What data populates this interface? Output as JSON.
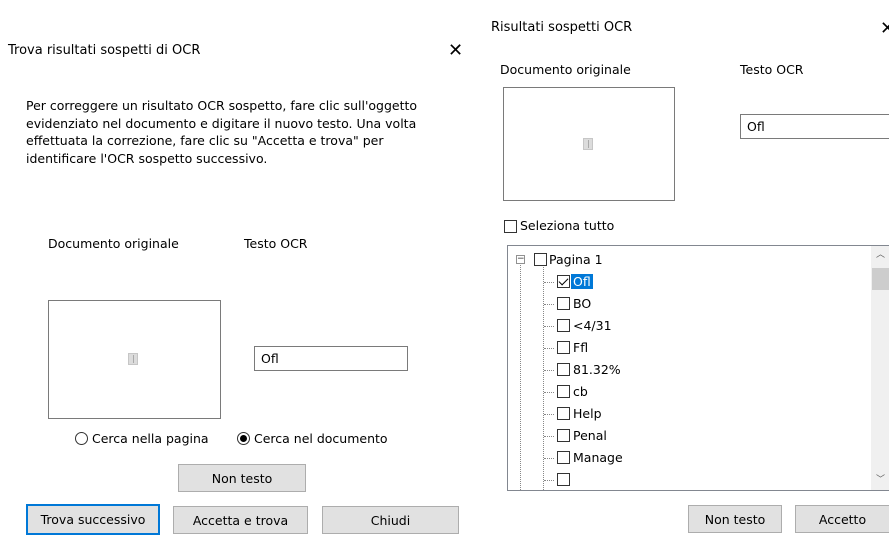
{
  "left_dialog": {
    "title": "Trova risultati sospetti di OCR",
    "instructions": [
      "Per correggere un risultato OCR sospetto, fare clic sull'oggetto",
      "evidenziato nel documento e digitare il nuovo testo. Una volta",
      "effettuata la correzione, fare clic su \"Accetta e trova\" per",
      "identificare l'OCR sospetto successivo."
    ],
    "original_label": "Documento originale",
    "ocr_label": "Testo OCR",
    "ocr_value": "Ofl",
    "radio_page": "Cerca nella pagina",
    "radio_document": "Cerca nel documento",
    "not_text_button": "Non testo",
    "find_next_button": "Trova successivo",
    "accept_find_button": "Accetta e trova",
    "close_button": "Chiudi"
  },
  "right_dialog": {
    "title": "Risultati sospetti OCR",
    "original_label": "Documento originale",
    "ocr_label": "Testo OCR",
    "ocr_value": "Ofl",
    "select_all": "Seleziona tutto",
    "tree": {
      "root": "Pagina 1",
      "items": [
        {
          "label": "Ofl",
          "checked": true,
          "selected": true
        },
        {
          "label": "BO",
          "checked": false,
          "selected": false
        },
        {
          "label": "<4/31",
          "checked": false,
          "selected": false
        },
        {
          "label": "Ffl",
          "checked": false,
          "selected": false
        },
        {
          "label": "81.32%",
          "checked": false,
          "selected": false
        },
        {
          "label": "cb",
          "checked": false,
          "selected": false
        },
        {
          "label": "Help",
          "checked": false,
          "selected": false
        },
        {
          "label": "Penal",
          "checked": false,
          "selected": false
        },
        {
          "label": "Manage",
          "checked": false,
          "selected": false
        }
      ]
    },
    "not_text_button": "Non testo",
    "accept_button": "Accetto"
  }
}
